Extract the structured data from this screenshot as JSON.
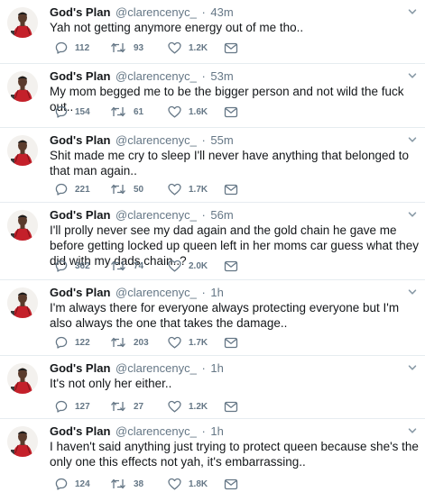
{
  "icons": {
    "reply": "reply-icon",
    "retweet": "retweet-icon",
    "like": "heart-icon",
    "dm": "envelope-icon",
    "caret": "chevron-down-icon",
    "avatar": "avatar"
  },
  "colors": {
    "name": "#14171a",
    "secondary": "#657786",
    "divider": "#e6ecf0"
  },
  "tweets": [
    {
      "display_name": "God's Plan",
      "handle": "@clarencenyc_",
      "separator": "·",
      "time": "43m",
      "text": "Yah not getting anymore energy out of me tho..",
      "replies": "112",
      "retweets": "93",
      "likes": "1.2K"
    },
    {
      "display_name": "God's Plan",
      "handle": "@clarencenyc_",
      "separator": "·",
      "time": "53m",
      "text": "My mom begged me to be the bigger person and not wild the fuck out..",
      "replies": "154",
      "retweets": "61",
      "likes": "1.6K"
    },
    {
      "display_name": "God's Plan",
      "handle": "@clarencenyc_",
      "separator": "·",
      "time": "55m",
      "text": "Shit made me cry to sleep I'll never have anything that belonged to that man again..",
      "replies": "221",
      "retweets": "50",
      "likes": "1.7K"
    },
    {
      "display_name": "God's Plan",
      "handle": "@clarencenyc_",
      "separator": "·",
      "time": "56m",
      "text": "I'll prolly never see my dad again and the gold chain he gave me before getting locked up queen left in her moms car guess what they did with my dads chain..?",
      "replies": "362",
      "retweets": "74",
      "likes": "2.0K"
    },
    {
      "display_name": "God's Plan",
      "handle": "@clarencenyc_",
      "separator": "·",
      "time": "1h",
      "text": "I'm always there for everyone always protecting everyone but I'm also always the one that takes the damage..",
      "replies": "122",
      "retweets": "203",
      "likes": "1.7K"
    },
    {
      "display_name": "God's Plan",
      "handle": "@clarencenyc_",
      "separator": "·",
      "time": "1h",
      "text": "It's not only her either..",
      "replies": "127",
      "retweets": "27",
      "likes": "1.2K"
    },
    {
      "display_name": "God's Plan",
      "handle": "@clarencenyc_",
      "separator": "·",
      "time": "1h",
      "text": "I haven't said anything just trying to protect queen because she's the only one this effects not yah, it's embarrassing..",
      "replies": "124",
      "retweets": "38",
      "likes": "1.8K"
    }
  ]
}
